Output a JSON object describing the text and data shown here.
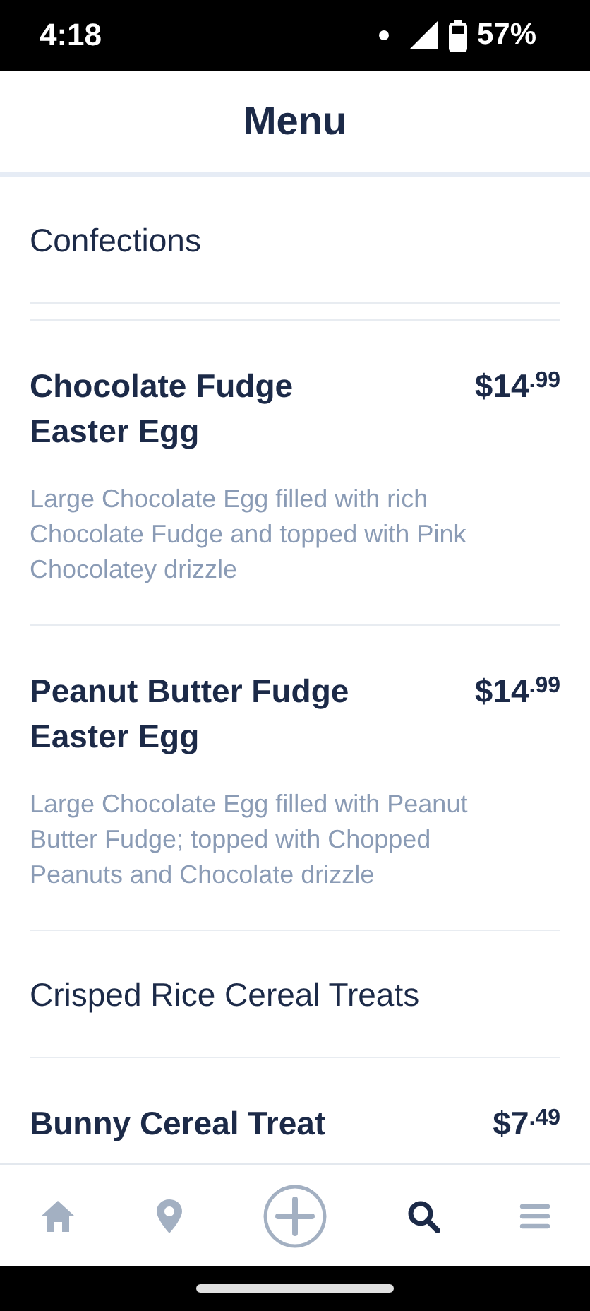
{
  "status_bar": {
    "time": "4:18",
    "battery": "57%"
  },
  "header": {
    "title": "Menu"
  },
  "sections": [
    {
      "heading": "Confections",
      "items": [
        {
          "name": "Chocolate Fudge Easter Egg",
          "price": "$14$^{.99}$",
          "description": "Large Chocolate Egg filled with rich Chocolate Fudge and topped with Pink Chocolatey drizzle"
        },
        {
          "name": "Peanut Butter Fudge Easter Egg",
          "price": "$14$^{.99}$",
          "description": "Large Chocolate Egg filled with Peanut Butter Fudge; topped with Chopped Peanuts and Chocolate drizzle"
        }
      ]
    },
    {
      "heading": "Crisped Rice Cereal Treats",
      "items": [
        {
          "name": "Bunny Cereal Treat",
          "price": "$7$^{.49}$"
        }
      ]
    }
  ],
  "nav": [
    {
      "kind": "home",
      "selected": false
    },
    {
      "kind": "location",
      "selected": false
    },
    {
      "kind": "add",
      "selected": false
    },
    {
      "kind": "search",
      "selected": true
    },
    {
      "kind": "menu",
      "selected": false
    }
  ]
}
